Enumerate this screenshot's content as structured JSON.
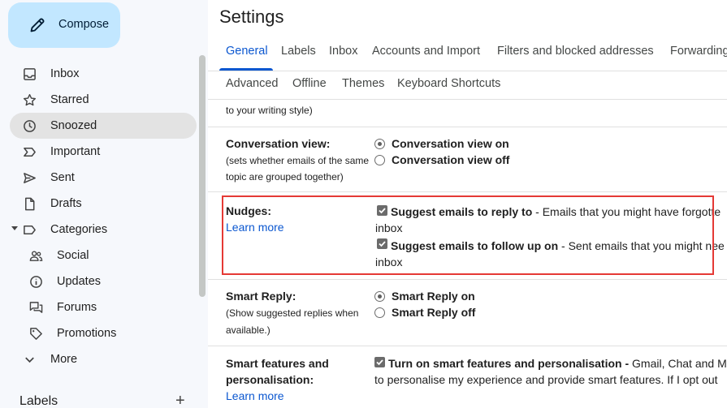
{
  "sidebar": {
    "compose_label": "Compose",
    "items": [
      {
        "label": "Inbox",
        "icon": "inbox-icon"
      },
      {
        "label": "Starred",
        "icon": "star-icon"
      },
      {
        "label": "Snoozed",
        "icon": "clock-icon"
      },
      {
        "label": "Important",
        "icon": "important-icon"
      },
      {
        "label": "Sent",
        "icon": "send-icon"
      },
      {
        "label": "Drafts",
        "icon": "draft-icon"
      },
      {
        "label": "Categories",
        "icon": "label-icon"
      },
      {
        "label": "Social",
        "icon": "people-icon"
      },
      {
        "label": "Updates",
        "icon": "info-icon"
      },
      {
        "label": "Forums",
        "icon": "forum-icon"
      },
      {
        "label": "Promotions",
        "icon": "tag-icon"
      },
      {
        "label": "More",
        "icon": "chevron-down-icon"
      }
    ],
    "labels_heading": "Labels",
    "labels_add": "+"
  },
  "settings": {
    "title": "Settings",
    "tabs_row1": [
      "General",
      "Labels",
      "Inbox",
      "Accounts and Import",
      "Filters and blocked addresses",
      "Forwarding"
    ],
    "tabs_row2": [
      "Advanced",
      "Offline",
      "Themes",
      "Keyboard Shortcuts"
    ],
    "active_tab": "General",
    "cut_text": "to your writing style)",
    "conversation_view": {
      "label": "Conversation view:",
      "hint_line1": "(sets whether emails of the same",
      "hint_line2": "topic are grouped together)",
      "option_on": "Conversation view on",
      "option_off": "Conversation view off",
      "selected": "on"
    },
    "nudges": {
      "label": "Nudges:",
      "learn_more": "Learn more",
      "opt1_bold": "Suggest emails to reply to",
      "opt1_rest": " - Emails that you might have forgotte",
      "opt1_wrap": "inbox",
      "opt2_bold": "Suggest emails to follow up on",
      "opt2_rest": " - Sent emails that you might nee",
      "opt2_wrap": "inbox",
      "opt1_checked": true,
      "opt2_checked": true
    },
    "smart_reply": {
      "label": "Smart Reply:",
      "hint_line1": "(Show suggested replies when",
      "hint_line2": "available.)",
      "option_on": "Smart Reply on",
      "option_off": "Smart Reply off",
      "selected": "on"
    },
    "smart_features": {
      "label_line1": "Smart features and",
      "label_line2": "personalisation:",
      "learn_more": "Learn more",
      "opt_bold": "Turn on smart features and personalisation -",
      "opt_rest": " Gmail, Chat and M",
      "opt_wrap": "to personalise my experience and provide smart features. If I opt out",
      "checked": true
    }
  },
  "colors": {
    "accent": "#0b57d0",
    "compose_bg": "#c2e7ff",
    "highlight_border": "#e53935"
  }
}
